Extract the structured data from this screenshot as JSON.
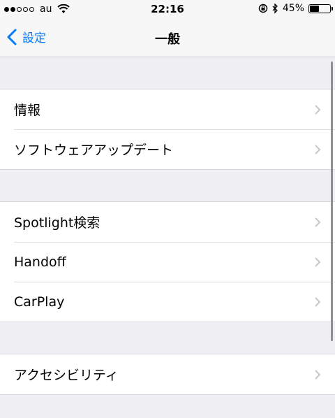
{
  "status_bar": {
    "carrier": "au",
    "time": "22:16",
    "battery_percent": "45%",
    "battery_level": 0.45
  },
  "nav": {
    "back_label": "設定",
    "title": "一般"
  },
  "groups": [
    {
      "items": [
        {
          "label": "情報"
        },
        {
          "label": "ソフトウェアアップデート"
        }
      ]
    },
    {
      "items": [
        {
          "label": "Spotlight検索"
        },
        {
          "label": "Handoff"
        },
        {
          "label": "CarPlay"
        }
      ]
    },
    {
      "items": [
        {
          "label": "アクセシビリティ"
        }
      ]
    }
  ],
  "colors": {
    "accent": "#007aff",
    "background": "#efeff4",
    "chevron": "#c7c7cc"
  },
  "icons": [
    "wifi-icon",
    "rotation-lock-icon",
    "bluetooth-icon",
    "battery-icon",
    "back-chevron-icon",
    "chevron-right-icon"
  ]
}
